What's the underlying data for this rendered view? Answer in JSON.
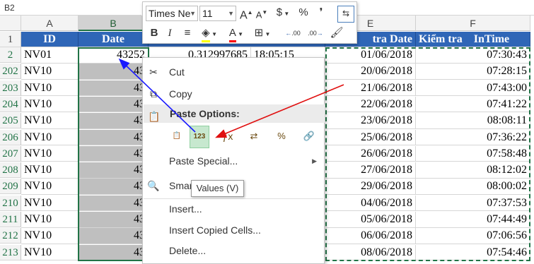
{
  "name_box": "B2",
  "columns": [
    "A",
    "B",
    "E",
    "F"
  ],
  "header_row": {
    "row_num": "1",
    "A": "ID",
    "B": "Date",
    "E": "tra   Date",
    "E2": "Kiểm tra",
    "F": "InTime"
  },
  "rows": [
    {
      "row": "2",
      "id": "NV01",
      "b": "43252",
      "c": "0.312997685",
      "d": "18:05:15",
      "date": "01/06/2018",
      "intime": "07:30:43"
    },
    {
      "row": "202",
      "id": "NV10",
      "b": "43",
      "date": "20/06/2018",
      "intime": "07:28:15"
    },
    {
      "row": "203",
      "id": "NV10",
      "b": "43",
      "date": "21/06/2018",
      "intime": "07:43:00"
    },
    {
      "row": "204",
      "id": "NV10",
      "b": "43",
      "date": "22/06/2018",
      "intime": "07:41:22"
    },
    {
      "row": "205",
      "id": "NV10",
      "b": "43",
      "date": "23/06/2018",
      "intime": "08:08:11"
    },
    {
      "row": "206",
      "id": "NV10",
      "b": "43",
      "date": "25/06/2018",
      "intime": "07:36:22"
    },
    {
      "row": "207",
      "id": "NV10",
      "b": "43",
      "date": "26/06/2018",
      "intime": "07:58:48"
    },
    {
      "row": "208",
      "id": "NV10",
      "b": "43",
      "date": "27/06/2018",
      "intime": "08:12:02"
    },
    {
      "row": "209",
      "id": "NV10",
      "b": "43",
      "date": "29/06/2018",
      "intime": "08:00:02"
    },
    {
      "row": "210",
      "id": "NV10",
      "b": "43",
      "date": "04/06/2018",
      "intime": "07:37:53"
    },
    {
      "row": "211",
      "id": "NV10",
      "b": "43",
      "date": "05/06/2018",
      "intime": "07:44:49"
    },
    {
      "row": "212",
      "id": "NV10",
      "b": "43",
      "date": "06/06/2018",
      "intime": "07:06:56"
    },
    {
      "row": "213",
      "id": "NV10",
      "b": "43",
      "date": "08/06/2018",
      "intime": "07:54:46"
    }
  ],
  "mini_toolbar": {
    "font_name": "Times Ne",
    "font_size": "11",
    "grow_font": "A",
    "shrink_font": "A",
    "currency": "$",
    "percent": "%",
    "bold": "B",
    "italic": "I",
    "font_color": "A",
    "inc_decimal": ".00",
    "dec_decimal": ".00"
  },
  "context_menu": {
    "cut": "Cut",
    "copy": "Copy",
    "paste_options": "Paste Options:",
    "paste_special": "Paste Special...",
    "smart_lookup": "Smart Lookup",
    "insert": "Insert...",
    "insert_copied": "Insert Copied Cells...",
    "delete": "Delete..."
  },
  "tooltip": "Values (V)",
  "paste_value_icon_text": "123",
  "colors": {
    "header_blue": "#2f66b7",
    "excel_green": "#217346",
    "selection_grey": "#bfbfbf",
    "arrow_blue": "#1a1aff",
    "arrow_red": "#e01010"
  }
}
